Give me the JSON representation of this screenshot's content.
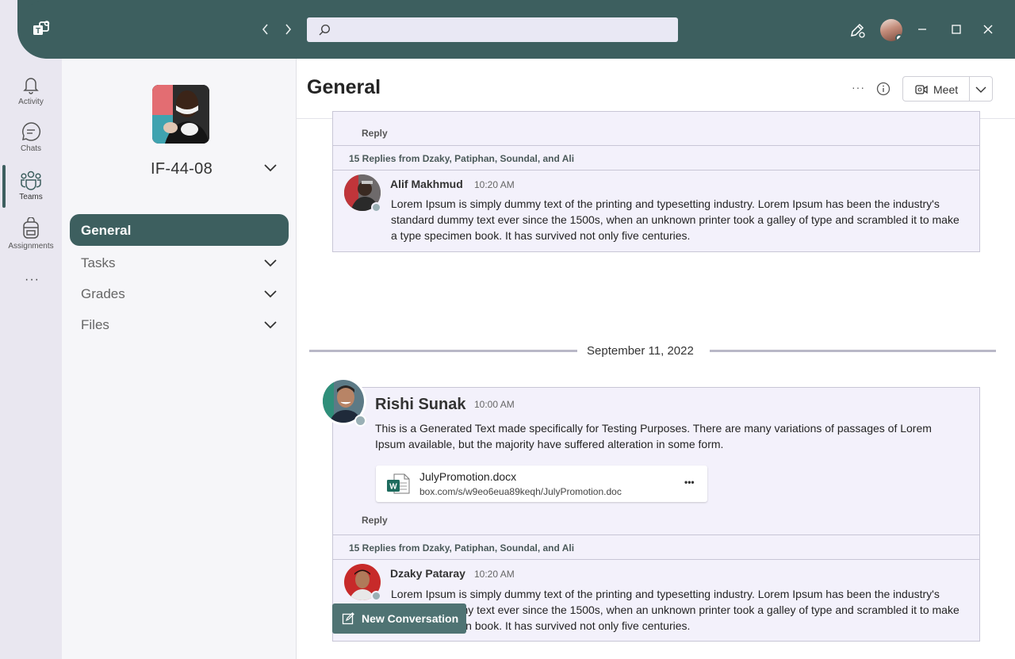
{
  "titlebar": {
    "search_placeholder": "",
    "icons": [
      "teams-logo-icon",
      "back-arrow-icon",
      "forward-arrow-icon",
      "search-icon",
      "compose-icon",
      "minimize-icon",
      "maximize-icon",
      "close-icon"
    ]
  },
  "rail": {
    "items": [
      {
        "label": "Activity",
        "icon": "bell-icon"
      },
      {
        "label": "Chats",
        "icon": "chat-icon"
      },
      {
        "label": "Teams",
        "icon": "teams-icon"
      },
      {
        "label": "Assignments",
        "icon": "backpack-icon"
      }
    ],
    "more": "···"
  },
  "team": {
    "name": "IF-44-08",
    "channels": [
      {
        "label": "General",
        "active": true
      },
      {
        "label": "Tasks"
      },
      {
        "label": "Grades"
      },
      {
        "label": "Files"
      }
    ]
  },
  "header": {
    "title": "General",
    "more": "···",
    "meet_label": "Meet"
  },
  "feed": {
    "thread1": {
      "reply_label": "Reply",
      "replies_text": "15 Replies from Dzaky, Patiphan, Soundal, and Ali",
      "reply": {
        "name": "Alif Makhmud",
        "time": "10:20 AM",
        "body": "Lorem Ipsum is simply dummy text of the printing and typesetting industry. Lorem Ipsum has been the industry's standard dummy text ever since the 1500s, when an unknown printer took a galley of type and scrambled it to make a type specimen book. It has survived not only five centuries."
      }
    },
    "date_divider": "September 11, 2022",
    "thread2": {
      "name": "Rishi Sunak",
      "time": "10:00 AM",
      "body": "This is a Generated Text made specifically for Testing Purposes. There are many variations of passages of Lorem Ipsum available, but the majority have suffered alteration in some form.",
      "attachment": {
        "name": "JulyPromotion.docx",
        "url": "box.com/s/w9eo6eua89keqh/JulyPromotion.doc",
        "more": "•••"
      },
      "reply_label": "Reply",
      "replies_text": "15 Replies from Dzaky, Patiphan, Soundal, and Ali",
      "reply": {
        "name": "Dzaky Pataray",
        "time": "10:20 AM",
        "body": "Lorem Ipsum is simply dummy text of the printing and typesetting industry. Lorem Ipsum has been the industry's standard dummy text ever since the 1500s, when an unknown printer took a galley of type and scrambled it to make a type specimen book. It has survived not only five centuries."
      }
    }
  },
  "new_conversation_label": "New Conversation",
  "colors": {
    "brand": "#3d5f5f",
    "button": "#4f7373",
    "card_bg": "#f3f1fb",
    "rail_bg": "#e9e7f0"
  }
}
